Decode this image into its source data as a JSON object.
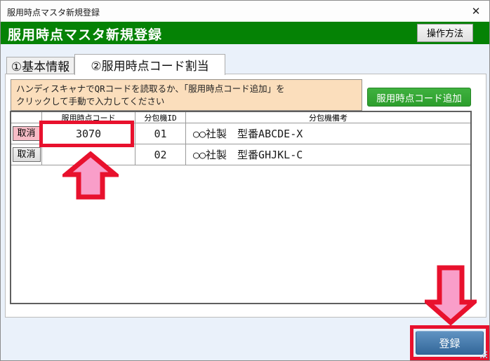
{
  "window": {
    "title": "服用時点マスタ新規登録",
    "close_glyph": "✕"
  },
  "header": {
    "title": "服用時点マスタ新規登録",
    "help_button_label": "操作方法"
  },
  "tabs": [
    {
      "label": "①基本情報",
      "active": false
    },
    {
      "label": "②服用時点コード割当",
      "active": true
    }
  ],
  "instruction": {
    "line1": "ハンディスキャナでQRコードを読取るか、「服用時点コード追加」を",
    "line2": "クリックして手動で入力してください"
  },
  "toolbar": {
    "add_code_button_label": "服用時点コード追加"
  },
  "table": {
    "headers": {
      "cancel": "",
      "code": "服用時点コード",
      "machine_id": "分包機ID",
      "remarks": "分包機備考"
    },
    "rows": [
      {
        "cancel_label": "取消",
        "code": "3070",
        "machine_id": "01",
        "remarks": "○○社製　型番ABCDE-X"
      },
      {
        "cancel_label": "取消",
        "code": "",
        "machine_id": "02",
        "remarks": "○○社製　型番GHJKL-C"
      }
    ]
  },
  "footer": {
    "register_button_label": "登録"
  },
  "colors": {
    "header_green": "#058205",
    "add_button_green": "#3FB13F",
    "register_button_blue": "#336799",
    "annotation_red": "#E8112D",
    "annotation_pink": "#F99EC9",
    "instruction_bg": "#FBDEBC",
    "cancel_highlight_pink": "#F6BCC6"
  }
}
